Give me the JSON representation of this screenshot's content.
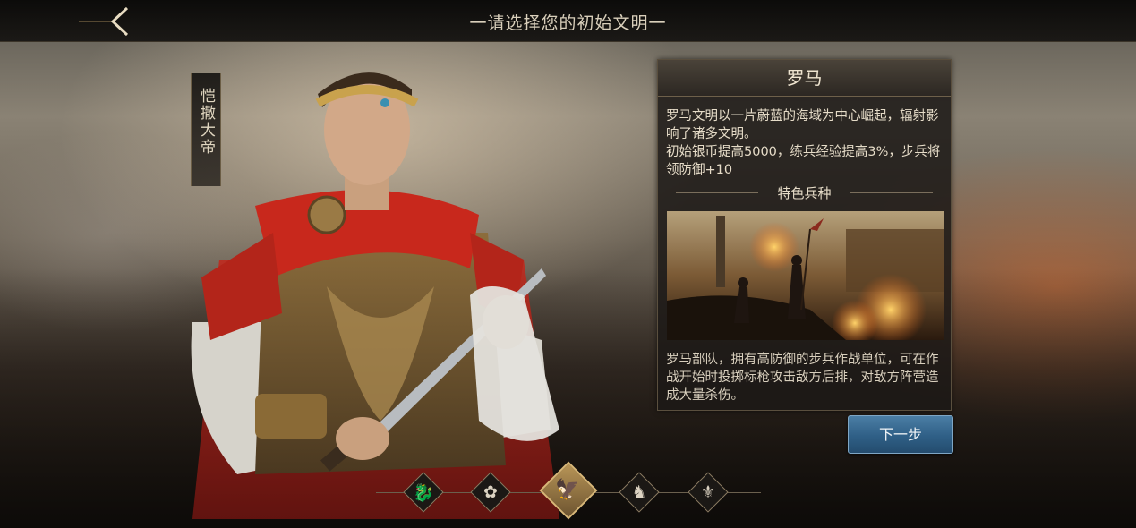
{
  "header": {
    "title": "一请选择您的初始文明一",
    "back_icon": "chevron-left-icon"
  },
  "leader": {
    "name": "恺撒大帝"
  },
  "panel": {
    "civ_name": "罗马",
    "description_1": "罗马文明以一片蔚蓝的海域为中心崛起，辐射影响了诸多文明。",
    "description_2": "初始银币提高5000，练兵经验提高3%，步兵将领防御+10",
    "special_unit_heading": "特色兵种",
    "unit_description": "罗马部队，拥有高防御的步兵作战单位，可在作战开始时投掷标枪攻击敌方后排，对敌方阵营造成大量杀伤。"
  },
  "actions": {
    "next_label": "下一步"
  },
  "civ_selector": [
    {
      "icon": "dragon-icon",
      "glyph": "🐉",
      "selected": false
    },
    {
      "icon": "rose-icon",
      "glyph": "✿",
      "selected": false
    },
    {
      "icon": "eagle-icon",
      "glyph": "🦅",
      "selected": true
    },
    {
      "icon": "lion-icon",
      "glyph": "♞",
      "selected": false
    },
    {
      "icon": "fleur-de-lis-icon",
      "glyph": "⚜",
      "selected": false
    }
  ],
  "colors": {
    "button_blue": "#2f5f86",
    "gold_accent": "#b89557",
    "panel_bg": "#1c1916"
  }
}
